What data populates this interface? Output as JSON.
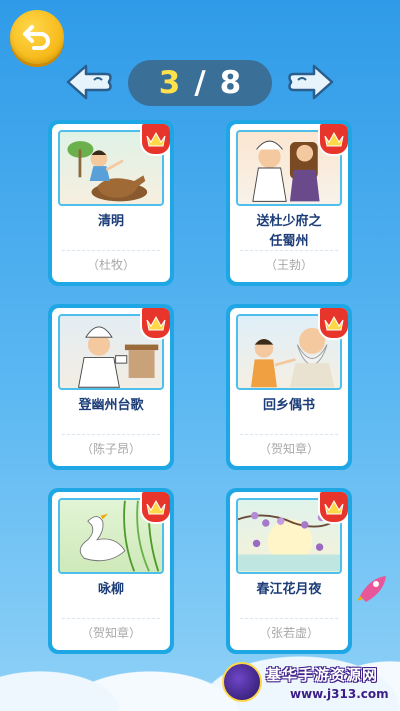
{
  "pager": {
    "current": "3",
    "separator": "/",
    "total": "8"
  },
  "poems": [
    {
      "title": "清明",
      "author": "（杜牧）"
    },
    {
      "title": "送杜少府之\n任蜀州",
      "author": "（王勃）"
    },
    {
      "title": "登幽州台歌",
      "author": "（陈子昂）"
    },
    {
      "title": "回乡偶书",
      "author": "（贺知章）"
    },
    {
      "title": "咏柳",
      "author": "（贺知章）"
    },
    {
      "title": "春江花月夜",
      "author": "（张若虚）"
    }
  ],
  "watermark": {
    "name": "基华手游资源网",
    "url": "www.j313.com"
  },
  "colors": {
    "card_border": "#1ea7e4",
    "title": "#1c3d78",
    "crown_badge": "#e8352b",
    "back_button": "#f5b800"
  }
}
